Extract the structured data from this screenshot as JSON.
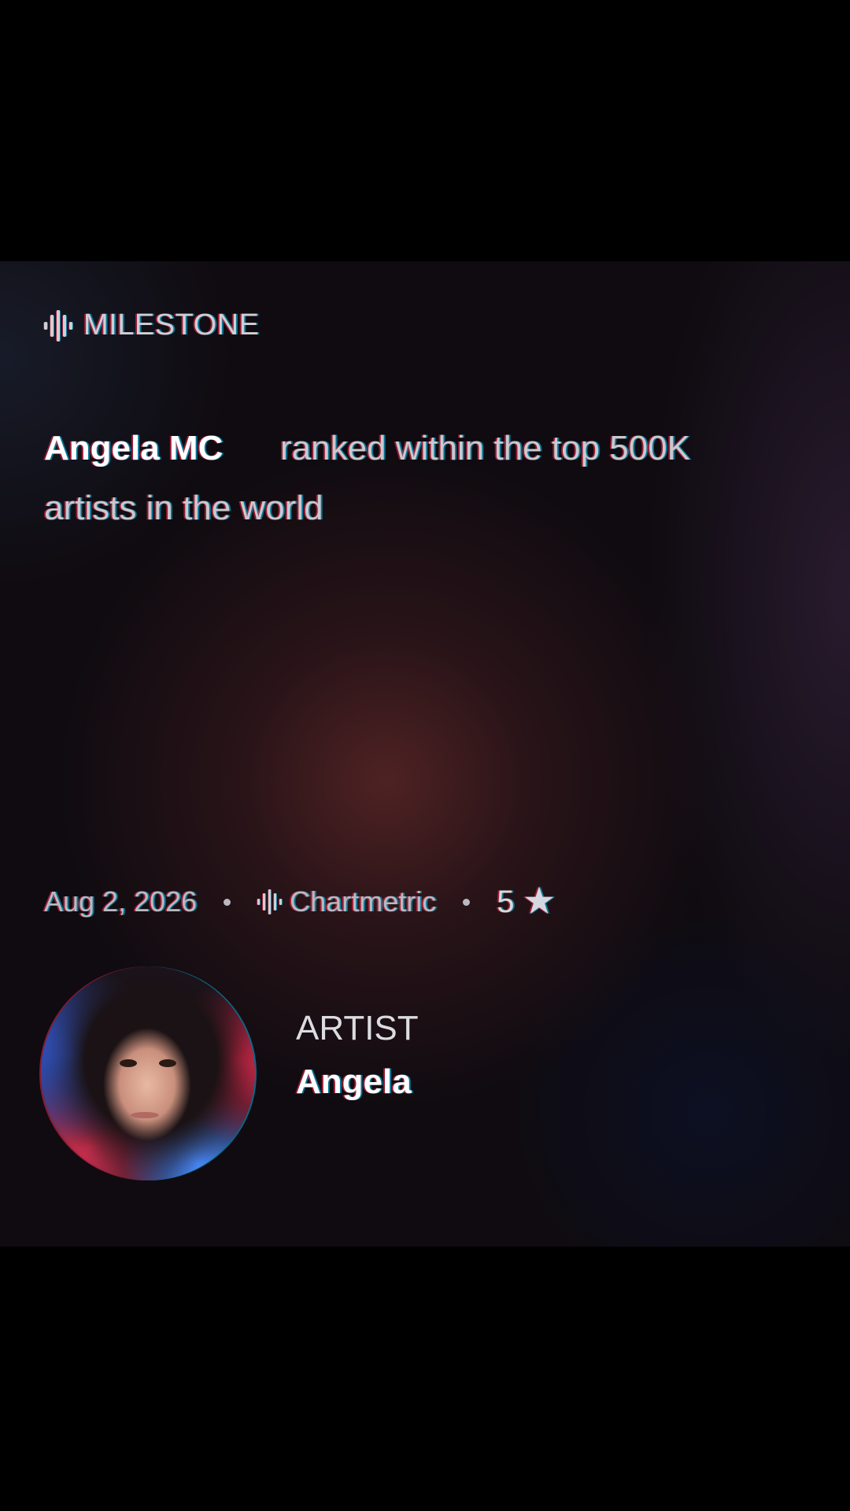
{
  "card": {
    "tag": {
      "icon": "waveform-icon",
      "label": "MILESTONE"
    },
    "headline": {
      "artist": "Angela MC",
      "text_line1": "ranked within the top 500K",
      "text_line2": "artists in the world"
    },
    "meta": {
      "date": "Aug 2, 2026",
      "source_icon": "waveform-icon",
      "source": "Chartmetric",
      "rating": "5",
      "rating_icon": "star-icon"
    },
    "artist": {
      "label": "ARTIST",
      "name": "Angela"
    }
  }
}
